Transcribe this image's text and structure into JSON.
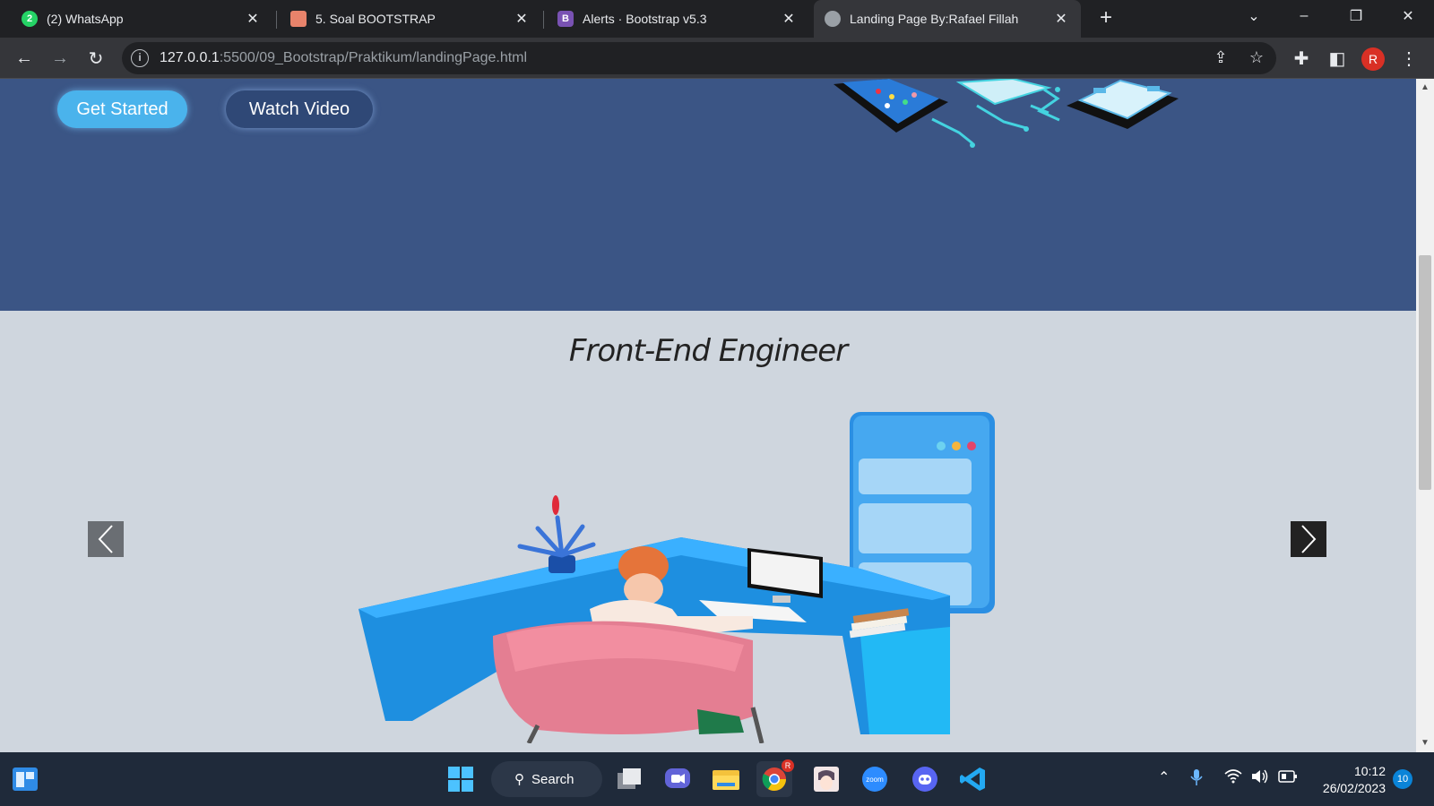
{
  "browser": {
    "tabs": [
      {
        "title": "(2) WhatsApp",
        "favicon": "whatsapp-icon",
        "favicon_text": "2",
        "favicon_color": "#25d366"
      },
      {
        "title": "5. Soal BOOTSTRAP",
        "favicon": "document-icon",
        "favicon_text": "",
        "favicon_color": "#e8836b"
      },
      {
        "title": "Alerts · Bootstrap v5.3",
        "favicon": "bootstrap-icon",
        "favicon_text": "B",
        "favicon_color": "#7952b3"
      },
      {
        "title": "Landing Page By:Rafael Fillah",
        "favicon": "globe-icon",
        "favicon_text": "",
        "favicon_color": "#9aa0a6",
        "active": true
      }
    ],
    "url_host": "127.0.0.1",
    "url_path": ":5500/09_Bootstrap/Praktikum/landingPage.html",
    "profile_initial": "R"
  },
  "page": {
    "hero": {
      "primary_button": "Get Started",
      "secondary_button": "Watch Video",
      "background_color": "#3b5585"
    },
    "section": {
      "title": "Front-End Engineer",
      "background_color": "#cfd6de"
    }
  },
  "taskbar": {
    "search_label": "Search",
    "apps": [
      "widgets-icon",
      "windows-start-icon",
      "task-view-icon",
      "teams-chat-icon",
      "file-explorer-icon",
      "chrome-icon",
      "anime-app-icon",
      "zoom-icon",
      "discord-icon",
      "vscode-icon"
    ],
    "zoom_label": "zoom",
    "chrome_badge": "R",
    "time": "10:12",
    "date": "26/02/2023",
    "notification_count": "10"
  }
}
